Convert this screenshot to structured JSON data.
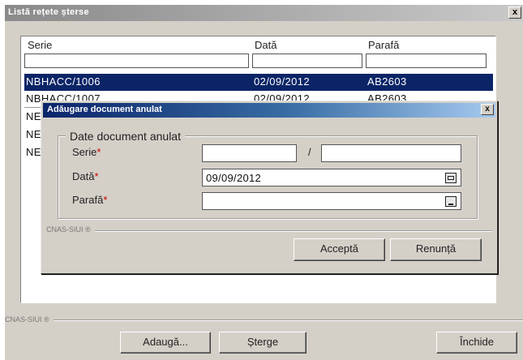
{
  "window": {
    "title": "Listă rețete șterse",
    "close_label": "x"
  },
  "list": {
    "columns": [
      "Serie",
      "Dată",
      "Parafă"
    ],
    "rows": [
      {
        "serie": "NBHACC/1006",
        "data": "02/09/2012",
        "parafa": "AB2603",
        "selected": true
      },
      {
        "serie": "NBHACC/1007",
        "data": "02/09/2012",
        "parafa": "AB2603",
        "selected": false
      },
      {
        "serie": "NE",
        "data": "",
        "parafa": "",
        "selected": false
      },
      {
        "serie": "NE",
        "data": "",
        "parafa": "",
        "selected": false
      },
      {
        "serie": "NE",
        "data": "",
        "parafa": "",
        "selected": false
      }
    ]
  },
  "footer": {
    "group_label": "CNAS-SIUI ®",
    "add_label": "Adaugă...",
    "delete_label": "Șterge",
    "close_label": "Închide"
  },
  "dialog": {
    "title": "Adăugare document anulat",
    "close_label": "x",
    "group_title": "Date document anulat",
    "serie_label": "Serie",
    "serie_value": "",
    "serie_suffix_value": "",
    "separator": "/",
    "data_label": "Dată",
    "data_value": "09/09/2012",
    "parafa_label": "Parafă",
    "parafa_value": "",
    "required_marker": "*",
    "footer_group_label": "CNAS-SIUI ®",
    "accept_label": "Acceptă",
    "cancel_label": "Renunță"
  },
  "colors": {
    "selection": "#0a2466",
    "dialog_title_start": "#0a246a",
    "required": "#d00000"
  }
}
